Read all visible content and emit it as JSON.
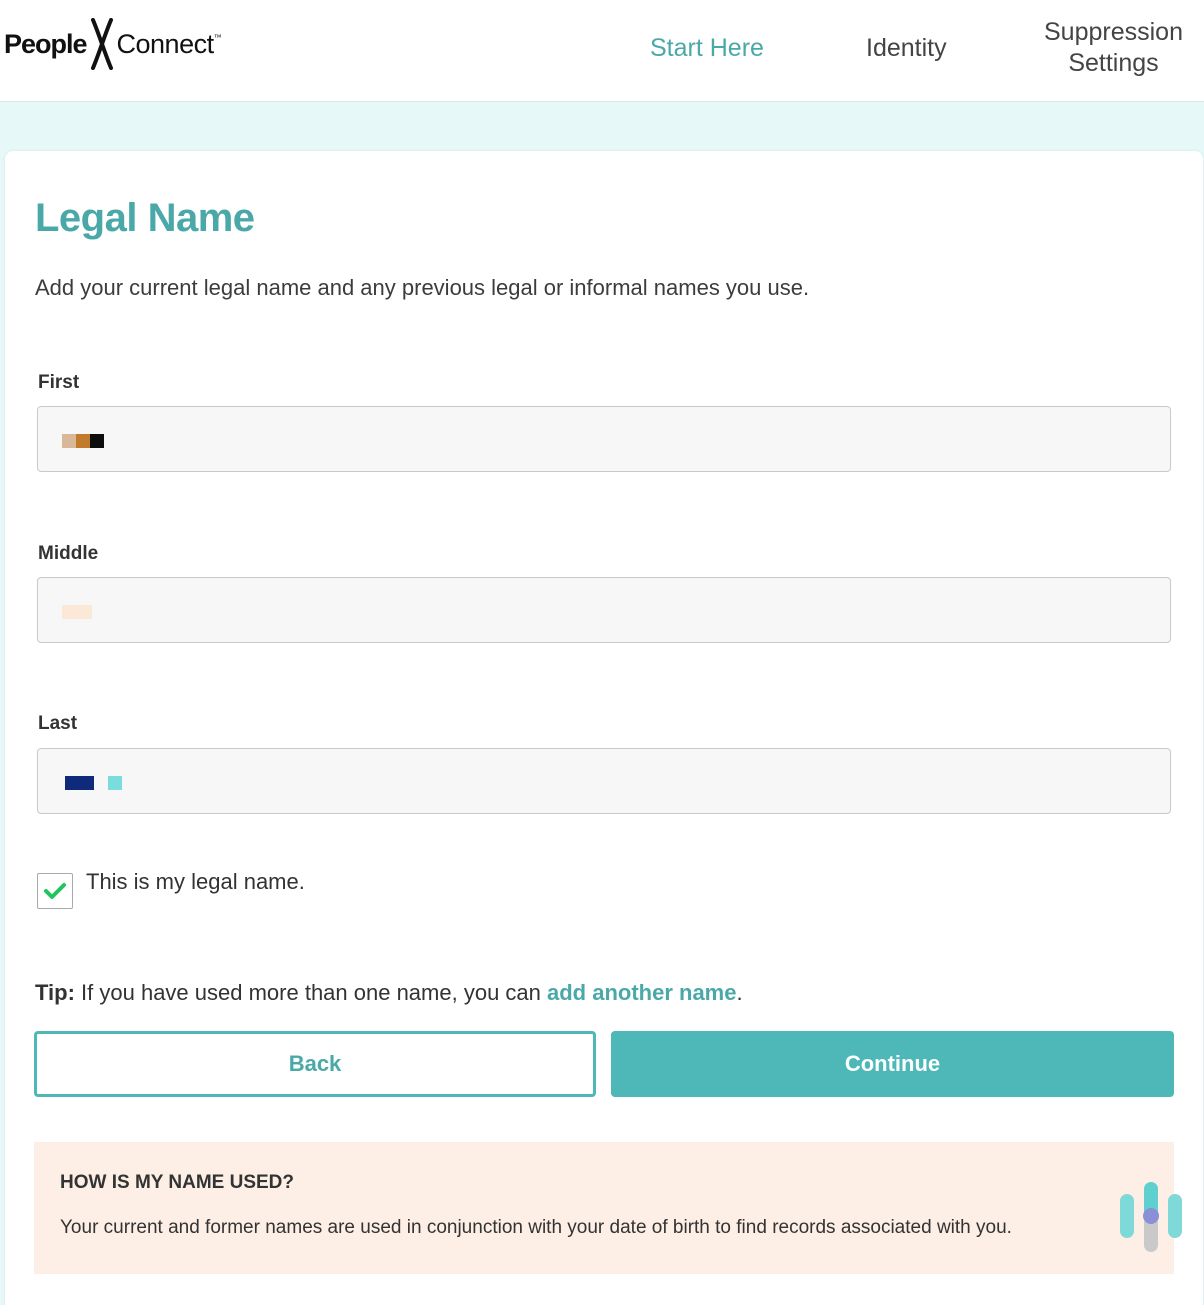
{
  "header": {
    "logo_people": "People",
    "logo_connect": "Connect",
    "logo_tm": "™",
    "nav": {
      "start_here": "Start Here",
      "identity": "Identity",
      "suppression_line1": "Suppression",
      "suppression_line2": "Settings"
    },
    "active_color": "#4aa9a8"
  },
  "form": {
    "title": "Legal Name",
    "subtitle": "Add your current legal name and any previous legal or informal names you use.",
    "first_label": "First",
    "middle_label": "Middle",
    "last_label": "Last",
    "legal_checkbox_label": "This is my legal name.",
    "legal_checkbox_checked": true,
    "tip_prefix": "Tip:",
    "tip_text": " If you have used more than one name, you can ",
    "tip_link": "add another name",
    "tip_suffix": ".",
    "back_label": "Back",
    "continue_label": "Continue"
  },
  "info_box": {
    "title": "HOW IS MY NAME USED?",
    "text": "Your current and former names are used in conjunction with your date of birth to find records associated with you."
  },
  "colors": {
    "accent": "#4db8b7",
    "page_bg": "#e6f8f7",
    "info_bg": "#fdefe6",
    "check": "#22c45e"
  }
}
